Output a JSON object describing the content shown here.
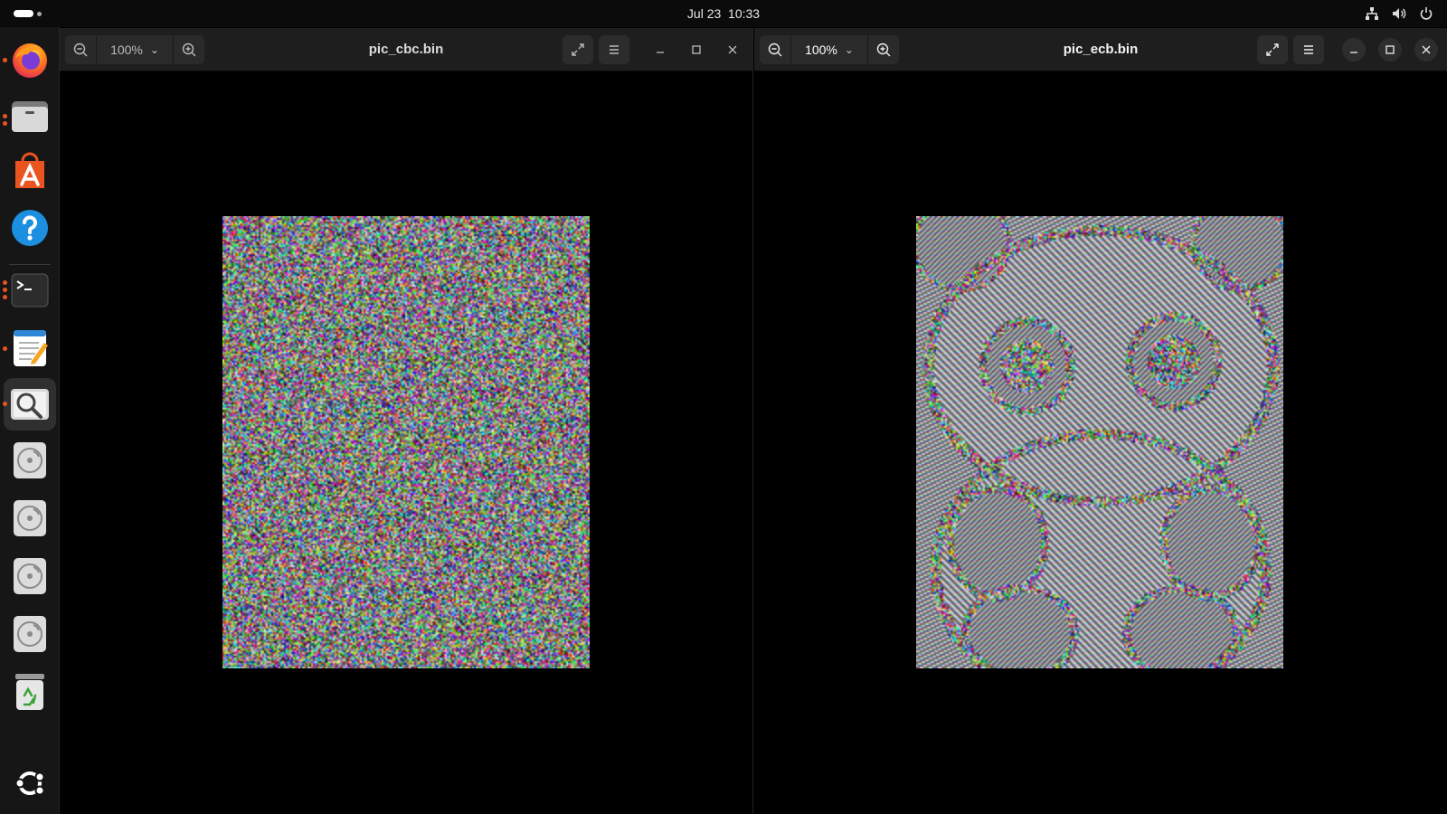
{
  "topbar": {
    "date": "Jul 23",
    "time": "10:33",
    "tray_icons": [
      "network-icon",
      "volume-icon",
      "power-icon"
    ]
  },
  "dock": {
    "items": [
      {
        "name": "firefox",
        "icon": "firefox-icon",
        "running": true
      },
      {
        "name": "files",
        "icon": "files-icon",
        "running": true
      },
      {
        "name": "app-center",
        "icon": "app-center-icon",
        "running": false
      },
      {
        "name": "help",
        "icon": "help-icon",
        "running": false
      },
      {
        "name": "terminal",
        "icon": "terminal-icon",
        "running": true
      },
      {
        "name": "text-editor",
        "icon": "text-editor-icon",
        "running": true
      },
      {
        "name": "image-viewer",
        "icon": "image-viewer-icon",
        "running": true,
        "active": true
      },
      {
        "name": "disc-1",
        "icon": "disc-icon",
        "running": false
      },
      {
        "name": "disc-2",
        "icon": "disc-icon",
        "running": false
      },
      {
        "name": "disc-3",
        "icon": "disc-icon",
        "running": false
      },
      {
        "name": "disc-4",
        "icon": "disc-icon",
        "running": false
      },
      {
        "name": "trash",
        "icon": "trash-icon",
        "running": false
      },
      {
        "name": "show-apps",
        "icon": "ubuntu-logo-icon",
        "running": false
      }
    ]
  },
  "windows": {
    "left": {
      "title": "pic_cbc.bin",
      "zoom": "100%",
      "focused": false,
      "image_kind": "random-noise"
    },
    "right": {
      "title": "pic_ecb.bin",
      "zoom": "100%",
      "focused": true,
      "image_kind": "ecb-panda-pattern"
    }
  },
  "colors": {
    "accent": "#e95420",
    "header_bg": "#1e1e1e",
    "dock_bg": "#161616",
    "topbar_bg": "#0b0b0b"
  }
}
